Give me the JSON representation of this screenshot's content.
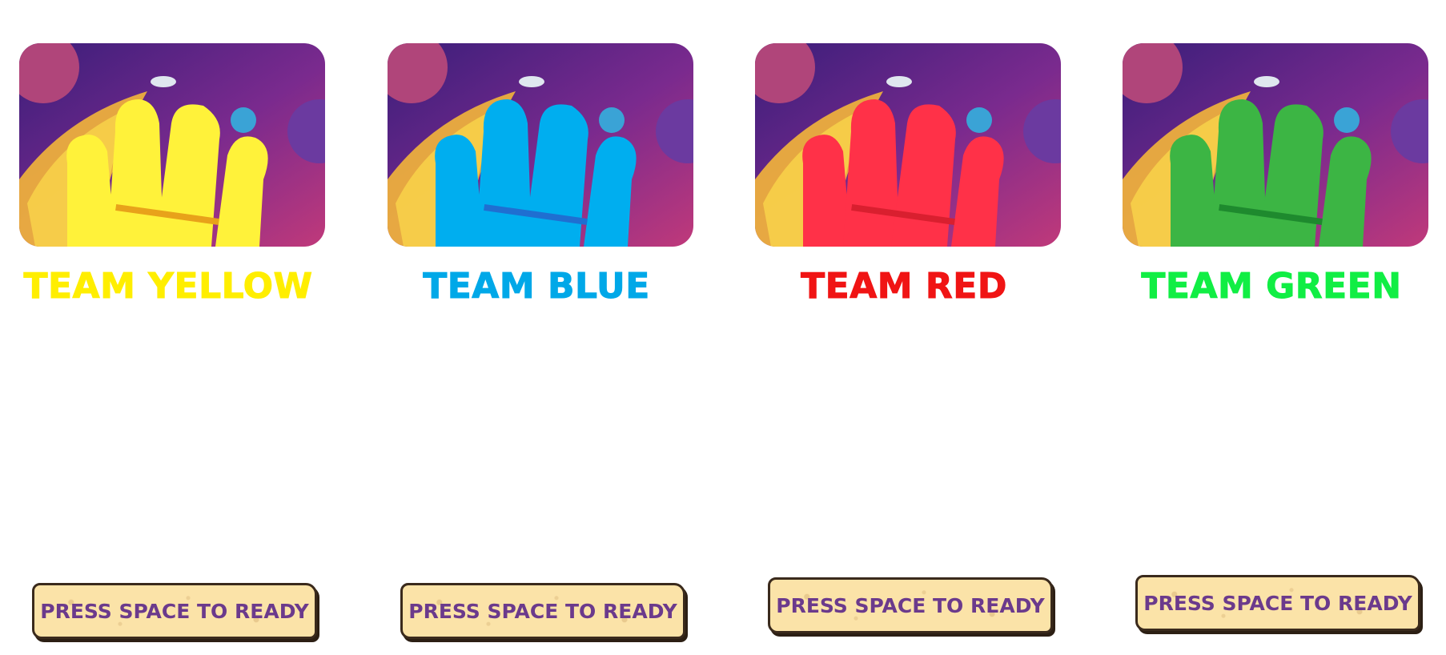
{
  "teams": [
    {
      "id": "yellow",
      "name": "TEAM YELLOW",
      "color": "#ffee00",
      "horse_color": "#fff23a",
      "horse_shade": "#e8d21a",
      "ready_label": "PRESS SPACE TO READY"
    },
    {
      "id": "blue",
      "name": "TEAM BLUE",
      "color": "#00a8e8",
      "horse_color": "#00aeef",
      "horse_shade": "#1f6fd1",
      "ready_label": "PRESS SPACE TO READY"
    },
    {
      "id": "red",
      "name": "TEAM RED",
      "color": "#f01414",
      "horse_color": "#ff3148",
      "horse_shade": "#d91f2f",
      "ready_label": "PRESS SPACE TO READY"
    },
    {
      "id": "green",
      "name": "TEAM GREEN",
      "color": "#11ee44",
      "horse_color": "#3cb544",
      "horse_shade": "#1e8a2e",
      "ready_label": "PRESS SPACE TO READY"
    }
  ],
  "theme": {
    "space_top": "#3a1e7a",
    "space_bottom": "#c0397a",
    "button_bg": "#fbe3a8",
    "button_text": "#6b3a8c"
  }
}
